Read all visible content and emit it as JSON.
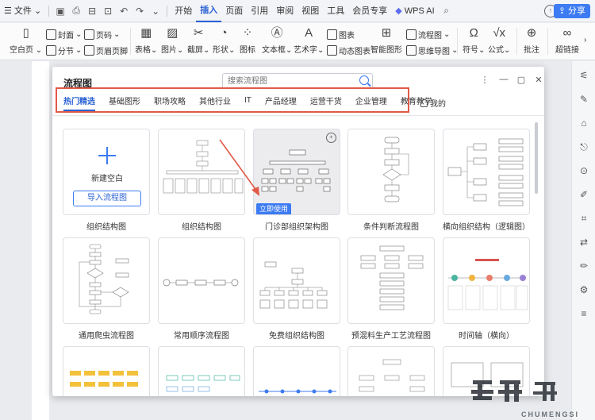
{
  "menubar": {
    "file_label": "文件",
    "tabs": [
      "开始",
      "插入",
      "页面",
      "引用",
      "审阅",
      "视图",
      "工具",
      "会员专享"
    ],
    "active_tab": "插入",
    "wps_ai": "WPS AI",
    "share": "分享"
  },
  "ribbon": {
    "blank_page": "空白页",
    "cover": "封面",
    "section": "分节",
    "page_number": "页码",
    "header_footer": "页眉页脚",
    "table": "表格",
    "picture": "图片",
    "screenshot": "截屏",
    "shape": "形状",
    "icon": "图标",
    "textbox": "文本框",
    "wordart": "艺术字",
    "chart": "图表",
    "dynamic_chart": "动态图表",
    "smart_graphic": "智能图形",
    "flowchart": "流程图",
    "mindmap": "思维导图",
    "symbol": "符号",
    "formula": "公式",
    "comment": "批注",
    "hyperlink": "超链接"
  },
  "dialog": {
    "title": "流程图",
    "search_placeholder": "搜索流程图",
    "tabs": [
      "热门精选",
      "基础图形",
      "职场攻略",
      "其他行业",
      "IT",
      "产品经理",
      "运营干货",
      "企业管理",
      "教育教学"
    ],
    "active_tab": "热门精选",
    "mine": "我的",
    "new_blank": "新建空白",
    "import_flowchart": "导入流程图",
    "use_now": "立即使用",
    "row1": [
      "组织结构图",
      "门诊部组织架构图",
      "条件判断流程图",
      "横向组织结构（逻辑图）"
    ],
    "row2": [
      "通用爬虫流程图",
      "常用顺序流程图",
      "免费组织结构图",
      "预混料生产工艺流程图",
      "时间轴（横向）"
    ]
  },
  "watermark": {
    "text": "CHUMENGSI"
  },
  "colors": {
    "accent": "#3d7bf2",
    "highlight_border": "#e05a47"
  }
}
